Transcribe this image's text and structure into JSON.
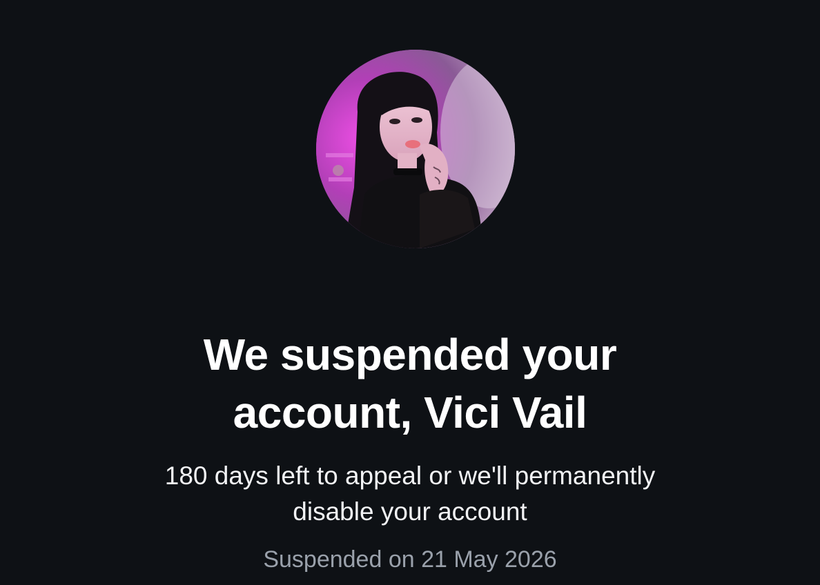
{
  "profile": {
    "avatar_alt": "Profile photo",
    "colors": {
      "background": "#0e1115",
      "title_text": "#ffffff",
      "body_text": "#f2f3f5",
      "meta_text": "#9aa1ab"
    }
  },
  "notice": {
    "title_line_1": "We suspended your",
    "title_line_2": "account, Vici Vail",
    "subtitle_line_1": "180 days left to appeal or we'll permanently",
    "subtitle_line_2": "disable your account",
    "suspended_on": "Suspended on 21 May 2026"
  }
}
